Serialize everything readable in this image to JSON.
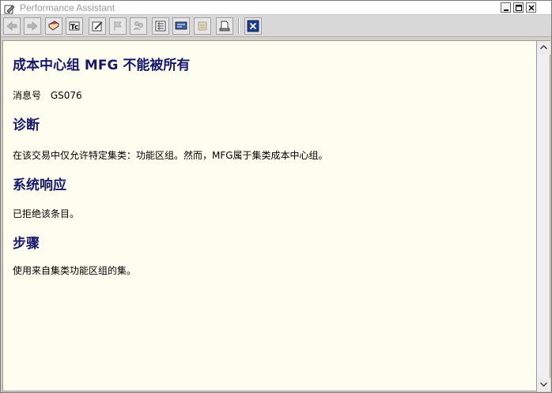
{
  "window": {
    "title": "Performance Assistant"
  },
  "toolbar": {
    "buttons": [
      {
        "icon": "back-arrow-icon",
        "enabled": false
      },
      {
        "icon": "forward-arrow-icon",
        "enabled": false
      },
      {
        "icon": "book-icon",
        "enabled": true
      },
      {
        "icon": "technical-info-icon",
        "enabled": true
      },
      {
        "icon": "edit-icon",
        "enabled": true
      },
      {
        "icon": "flag-icon",
        "enabled": false
      },
      {
        "icon": "users-icon",
        "enabled": false
      },
      {
        "icon": "list-icon",
        "enabled": true
      },
      {
        "icon": "display-icon",
        "enabled": true
      },
      {
        "icon": "export-icon",
        "enabled": false
      },
      {
        "icon": "print-icon",
        "enabled": true
      },
      {
        "icon": "close-icon",
        "enabled": true
      }
    ]
  },
  "message": {
    "title": "成本中心组  MFG 不能被所有",
    "number_label": "消息号",
    "number": "GS076",
    "sections": [
      {
        "heading": "诊断",
        "text": "在该交易中仅允许特定集类：功能区组。然而，MFG属于集类成本中心组。"
      },
      {
        "heading": "系统响应",
        "text": "已拒绝该条目。"
      },
      {
        "heading": "步骤",
        "text": "使用来自集类功能区组的集。"
      }
    ]
  },
  "colors": {
    "content_background": "#fefef0",
    "heading": "#17176b"
  }
}
